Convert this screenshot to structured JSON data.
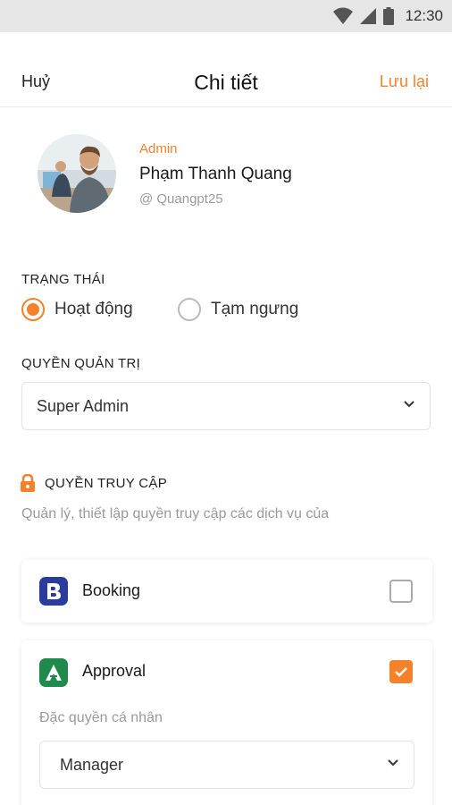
{
  "status_bar": {
    "time": "12:30"
  },
  "header": {
    "cancel_label": "Huỷ",
    "title": "Chi tiết",
    "save_label": "Lưu lại"
  },
  "profile": {
    "role": "Admin",
    "name": "Phạm Thanh Quang",
    "handle": "@ Quangpt25"
  },
  "status_section": {
    "label": "TRẠNG THÁI",
    "options": [
      {
        "label": "Hoạt động",
        "selected": true
      },
      {
        "label": "Tạm ngưng",
        "selected": false
      }
    ]
  },
  "admin_section": {
    "label": "QUYỀN QUẢN TRỊ",
    "selected_value": "Super Admin"
  },
  "access_section": {
    "label": "QUYỀN TRUY CẬP",
    "description": "Quản lý, thiết lập quyền truy cập các dịch vụ của",
    "apps": [
      {
        "name": "Booking",
        "icon": "booking-icon",
        "icon_color": "#2b3d9c",
        "checked": false
      },
      {
        "name": "Approval",
        "icon": "approval-icon",
        "icon_color": "#1f8a4c",
        "checked": true,
        "privilege_label": "Đặc quyền cá nhân",
        "privilege_value": "Manager"
      }
    ]
  },
  "colors": {
    "accent": "#f5822a",
    "status_bar": "#e6e6e6",
    "muted_text": "#9a9a9a"
  }
}
